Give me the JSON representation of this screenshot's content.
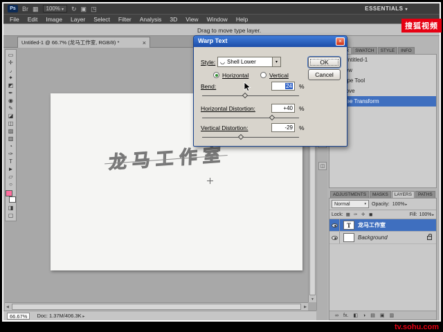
{
  "app_bar": {
    "ps_logo": "Ps",
    "bridge_label": "Br",
    "icons": [
      {
        "name": "view-extras-icon",
        "glyph": "▦"
      },
      {
        "name": "rotate-view-icon",
        "glyph": "↻"
      },
      {
        "name": "arrange-documents-icon",
        "glyph": "▣"
      },
      {
        "name": "screen-mode-icon",
        "glyph": "◳"
      }
    ],
    "zoom": "100%",
    "workspace": "ESSENTIALS"
  },
  "menu": {
    "items": [
      "File",
      "Edit",
      "Image",
      "Layer",
      "Select",
      "Filter",
      "Analysis",
      "3D",
      "View",
      "Window",
      "Help"
    ]
  },
  "options_bar": {
    "hint": "Drag to move type layer."
  },
  "document": {
    "tab_title": "Untitled-1 @ 66.7% (龙马工作室, RGB/8) *",
    "close_icon": "×",
    "canvas_text": "龙马工作室"
  },
  "toolbar": {
    "tools": [
      {
        "name": "rectangular-marquee-tool",
        "glyph": "▭"
      },
      {
        "name": "move-tool",
        "glyph": "✛"
      },
      {
        "name": "lasso-tool",
        "glyph": "◞"
      },
      {
        "name": "quick-selection-tool",
        "glyph": "✦"
      },
      {
        "name": "crop-tool",
        "glyph": "◩"
      },
      {
        "name": "eyedropper-tool",
        "glyph": "✒"
      },
      {
        "name": "spot-healing-brush-tool",
        "glyph": "◉"
      },
      {
        "name": "brush-tool",
        "glyph": "✎"
      },
      {
        "name": "clone-stamp-tool",
        "glyph": "◪"
      },
      {
        "name": "history-brush-tool",
        "glyph": "◫"
      },
      {
        "name": "eraser-tool",
        "glyph": "▨"
      },
      {
        "name": "gradient-tool",
        "glyph": "▥"
      },
      {
        "name": "blur-tool",
        "glyph": "◔"
      },
      {
        "name": "pen-tool",
        "glyph": "✑"
      },
      {
        "name": "type-tool",
        "glyph": "T"
      },
      {
        "name": "path-selection-tool",
        "glyph": "►"
      },
      {
        "name": "rectangle-tool",
        "glyph": "▱"
      },
      {
        "name": "zoom-tool",
        "glyph": "○"
      }
    ],
    "extra": [
      {
        "name": "quick-mask-mode",
        "glyph": "◨"
      },
      {
        "name": "screen-mode",
        "glyph": "▢"
      }
    ]
  },
  "dock": {
    "collapse_icon": "«",
    "icons": [
      {
        "name": "collapsed-panel-1",
        "glyph": "▤"
      },
      {
        "name": "collapsed-panel-2",
        "glyph": "✦"
      },
      {
        "name": "collapsed-panel-3",
        "glyph": "◫"
      }
    ]
  },
  "dialog": {
    "title": "Warp Text",
    "style_label": "Style:",
    "style_icon": "◡",
    "style_value": "Shell Lower",
    "radio_horizontal": "Horizontal",
    "radio_vertical": "Vertical",
    "bend_label": "Bend:",
    "bend_value": "24",
    "h_label": "Horizontal Distortion:",
    "h_value": "+40",
    "v_label": "Vertical Distortion:",
    "v_value": "-29",
    "percent": "%",
    "ok_label": "OK",
    "cancel_label": "Cancel"
  },
  "history_panel": {
    "tabs": [
      "COLOR",
      "SWATCH",
      "STYLE",
      "INFO"
    ],
    "items": [
      {
        "label": "Untitled-1",
        "icon": ""
      },
      {
        "label": "New",
        "icon": "▢"
      },
      {
        "label": "Type Tool",
        "icon": "T"
      },
      {
        "label": "Move",
        "icon": "✛"
      },
      {
        "label": "Free Transform",
        "icon": "⊞"
      }
    ]
  },
  "layers_panel": {
    "tabs": [
      "ADJUSTMENTS",
      "MASKS",
      "LAYERS",
      "PATHS"
    ],
    "blend_mode": "Normal",
    "opacity_label": "Opacity:",
    "opacity_value": "100%",
    "lock_label": "Lock:",
    "lock_icons": [
      {
        "name": "lock-transparency-icon",
        "glyph": "▦"
      },
      {
        "name": "lock-pixels-icon",
        "glyph": "✑"
      },
      {
        "name": "lock-position-icon",
        "glyph": "✛"
      },
      {
        "name": "lock-all-icon",
        "glyph": "◼"
      }
    ],
    "fill_label": "Fill:",
    "fill_value": "100%",
    "layers": [
      {
        "name": "龙马工作室",
        "thumb_glyph": "T"
      },
      {
        "name": "Background",
        "thumb_glyph": ""
      }
    ],
    "footer_icons": [
      {
        "name": "link-layers-icon",
        "glyph": "∞"
      },
      {
        "name": "layer-style-icon",
        "glyph": "fx."
      },
      {
        "name": "layer-mask-icon",
        "glyph": "◧"
      },
      {
        "name": "adjustment-layer-icon",
        "glyph": "◑"
      },
      {
        "name": "layer-group-icon",
        "glyph": "▤"
      },
      {
        "name": "new-layer-icon",
        "glyph": "▣"
      },
      {
        "name": "delete-layer-icon",
        "glyph": "▥"
      }
    ]
  },
  "status_bar": {
    "zoom": "66.67%",
    "doc_info": "Doc: 1.37M/406.3K"
  },
  "watermark": {
    "logo_text": "搜狐视频",
    "site_text": "tv.sohu.com"
  }
}
